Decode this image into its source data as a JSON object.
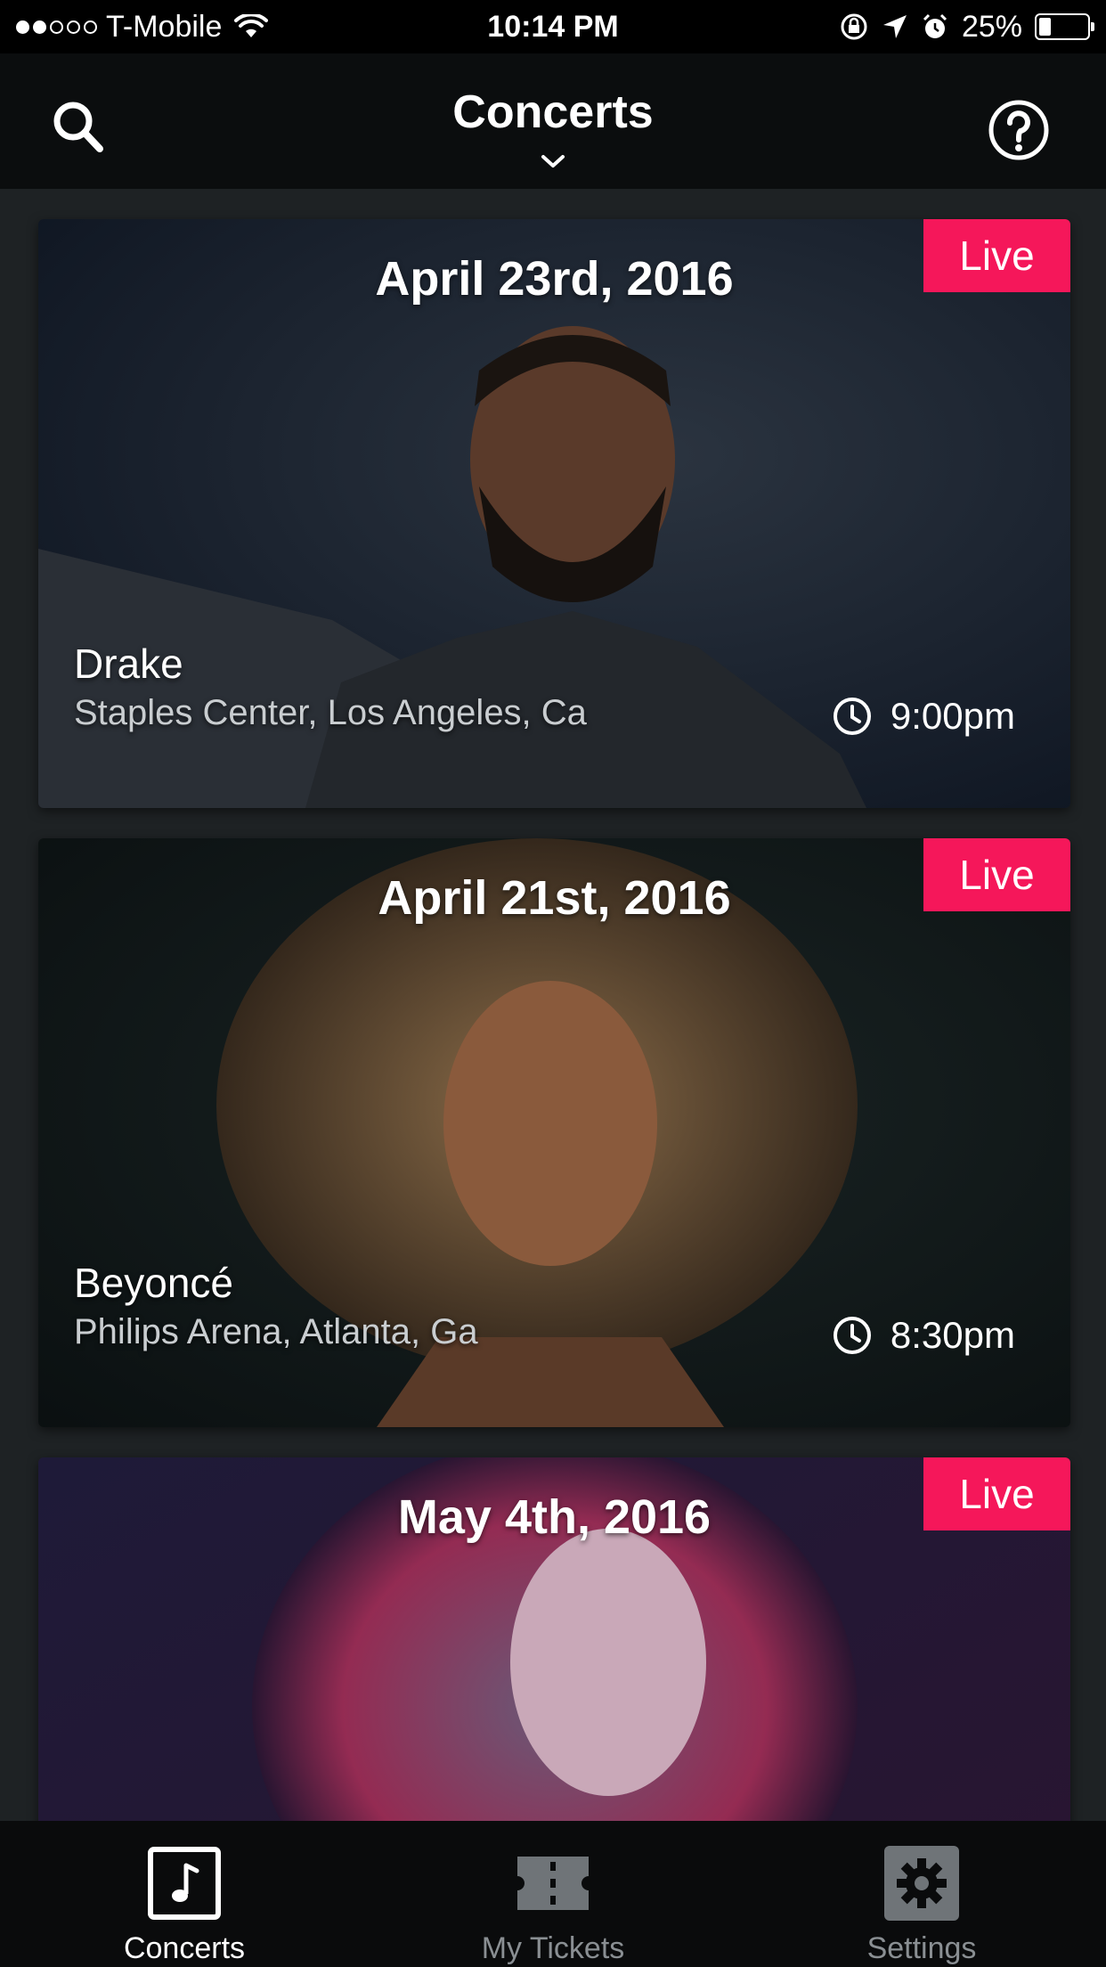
{
  "status_bar": {
    "carrier": "T-Mobile",
    "time": "10:14 PM",
    "battery_percent": "25%",
    "battery_level": 0.25,
    "signal_bars_filled": 2,
    "signal_bars_total": 5
  },
  "nav": {
    "title": "Concerts",
    "search_icon": "search-icon",
    "help_icon": "help-icon"
  },
  "concerts": [
    {
      "date": "April 23rd, 2016",
      "badge": "Live",
      "artist": "Drake",
      "venue": "Staples Center, Los Angeles, Ca",
      "time": "9:00pm"
    },
    {
      "date": "April 21st, 2016",
      "badge": "Live",
      "artist": "Beyoncé",
      "venue": "Philips Arena, Atlanta, Ga",
      "time": "8:30pm"
    },
    {
      "date": "May 4th, 2016",
      "badge": "Live"
    }
  ],
  "tabs": [
    {
      "label": "Concerts",
      "icon": "music-note-icon",
      "active": true
    },
    {
      "label": "My Tickets",
      "icon": "ticket-icon",
      "active": false
    },
    {
      "label": "Settings",
      "icon": "gear-icon",
      "active": false
    }
  ],
  "colors": {
    "live_badge": "#f5175a",
    "background": "#1e2224",
    "tab_inactive": "#8a8f93"
  }
}
